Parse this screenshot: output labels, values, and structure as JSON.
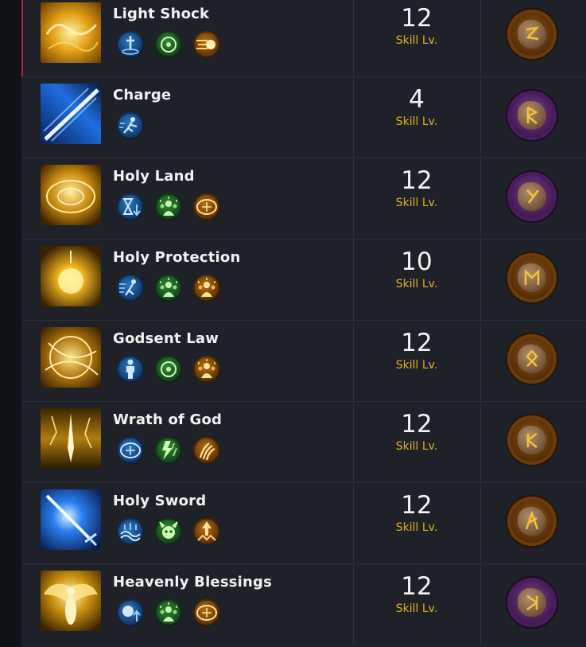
{
  "level_label": "Skill Lv.",
  "colors": {
    "level_label": "#e5b21c",
    "name": "#f2f2f2",
    "active_bar": "#b1283c"
  },
  "skills": [
    {
      "name": "Light Shock",
      "level": "12",
      "icon": "light-shock-icon",
      "rune": "orange",
      "tags": [
        {
          "icon": "sword-strike-icon",
          "color": "blue"
        },
        {
          "icon": "target-icon",
          "color": "green"
        },
        {
          "icon": "projectile-icon",
          "color": "gold"
        }
      ]
    },
    {
      "name": "Charge",
      "level": "4",
      "icon": "charge-icon",
      "rune": "purple",
      "tags": [
        {
          "icon": "dash-icon",
          "color": "blue"
        }
      ]
    },
    {
      "name": "Holy Land",
      "level": "12",
      "icon": "holy-land-icon",
      "rune": "purple",
      "tags": [
        {
          "icon": "hourglass-down-icon",
          "color": "blue"
        },
        {
          "icon": "party-buff-icon",
          "color": "green"
        },
        {
          "icon": "area-icon",
          "color": "gold"
        }
      ]
    },
    {
      "name": "Holy Protection",
      "level": "10",
      "icon": "holy-protection-icon",
      "rune": "orange",
      "tags": [
        {
          "icon": "speed-icon",
          "color": "blue"
        },
        {
          "icon": "party-buff-icon",
          "color": "green"
        },
        {
          "icon": "party-shield-icon",
          "color": "gold"
        }
      ]
    },
    {
      "name": "Godsent Law",
      "level": "12",
      "icon": "godsent-law-icon",
      "rune": "orange",
      "tags": [
        {
          "icon": "stand-icon",
          "color": "blue"
        },
        {
          "icon": "target-icon",
          "color": "green"
        },
        {
          "icon": "party-shield-icon",
          "color": "gold"
        }
      ]
    },
    {
      "name": "Wrath of God",
      "level": "12",
      "icon": "wrath-of-god-icon",
      "rune": "orange",
      "tags": [
        {
          "icon": "area-icon",
          "color": "blue"
        },
        {
          "icon": "lightning-icon",
          "color": "green"
        },
        {
          "icon": "claw-icon",
          "color": "gold"
        }
      ]
    },
    {
      "name": "Holy Sword",
      "level": "12",
      "icon": "holy-sword-icon",
      "rune": "orange",
      "tags": [
        {
          "icon": "wave-icon",
          "color": "blue"
        },
        {
          "icon": "demon-icon",
          "color": "green"
        },
        {
          "icon": "burst-up-icon",
          "color": "gold"
        }
      ]
    },
    {
      "name": "Heavenly Blessings",
      "level": "12",
      "icon": "heavenly-blessings-icon",
      "rune": "purple",
      "tags": [
        {
          "icon": "orb-up-icon",
          "color": "blue"
        },
        {
          "icon": "party-buff-icon",
          "color": "green"
        },
        {
          "icon": "area-icon",
          "color": "gold"
        }
      ]
    }
  ]
}
